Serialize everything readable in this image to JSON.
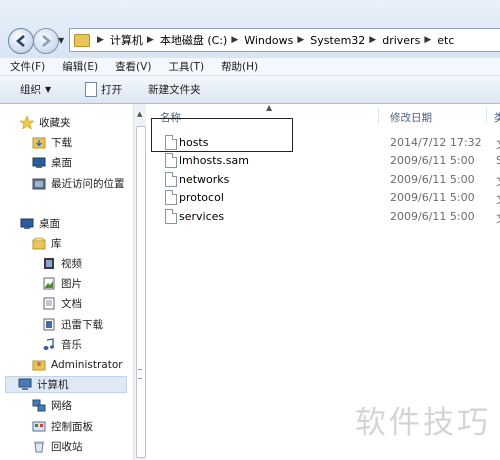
{
  "address": {
    "crumbs": [
      "计算机",
      "本地磁盘 (C:)",
      "Windows",
      "System32",
      "drivers",
      "etc"
    ]
  },
  "menu": [
    "文件(F)",
    "编辑(E)",
    "查看(V)",
    "工具(T)",
    "帮助(H)"
  ],
  "toolbar": {
    "organize_label": "组织",
    "open_label": "打开",
    "new_folder_label": "新建文件夹"
  },
  "nav": {
    "favorites": "收藏夹",
    "downloads": "下载",
    "desktop_fav": "桌面",
    "recent": "最近访问的位置",
    "desktop": "桌面",
    "libraries": "库",
    "videos": "视频",
    "pictures": "图片",
    "documents": "文档",
    "xunlei": "迅雷下载",
    "music": "音乐",
    "administrator": "Administrator",
    "computer": "计算机",
    "network": "网络",
    "control_panel": "控制面板",
    "recycle_bin": "回收站"
  },
  "columns": {
    "name": "名称",
    "date": "修改日期",
    "type": "类"
  },
  "files": [
    {
      "name": "hosts",
      "date": "2014/7/12 17:32",
      "type": "文"
    },
    {
      "name": "lmhosts.sam",
      "date": "2009/6/11 5:00",
      "type": "S"
    },
    {
      "name": "networks",
      "date": "2009/6/11 5:00",
      "type": "文"
    },
    {
      "name": "protocol",
      "date": "2009/6/11 5:00",
      "type": "文"
    },
    {
      "name": "services",
      "date": "2009/6/11 5:00",
      "type": "文"
    }
  ],
  "watermark": "软件技巧",
  "colors": {
    "folder": "#e7c45c",
    "selection": "#dfe8f4",
    "annotation_box": "#222222"
  }
}
